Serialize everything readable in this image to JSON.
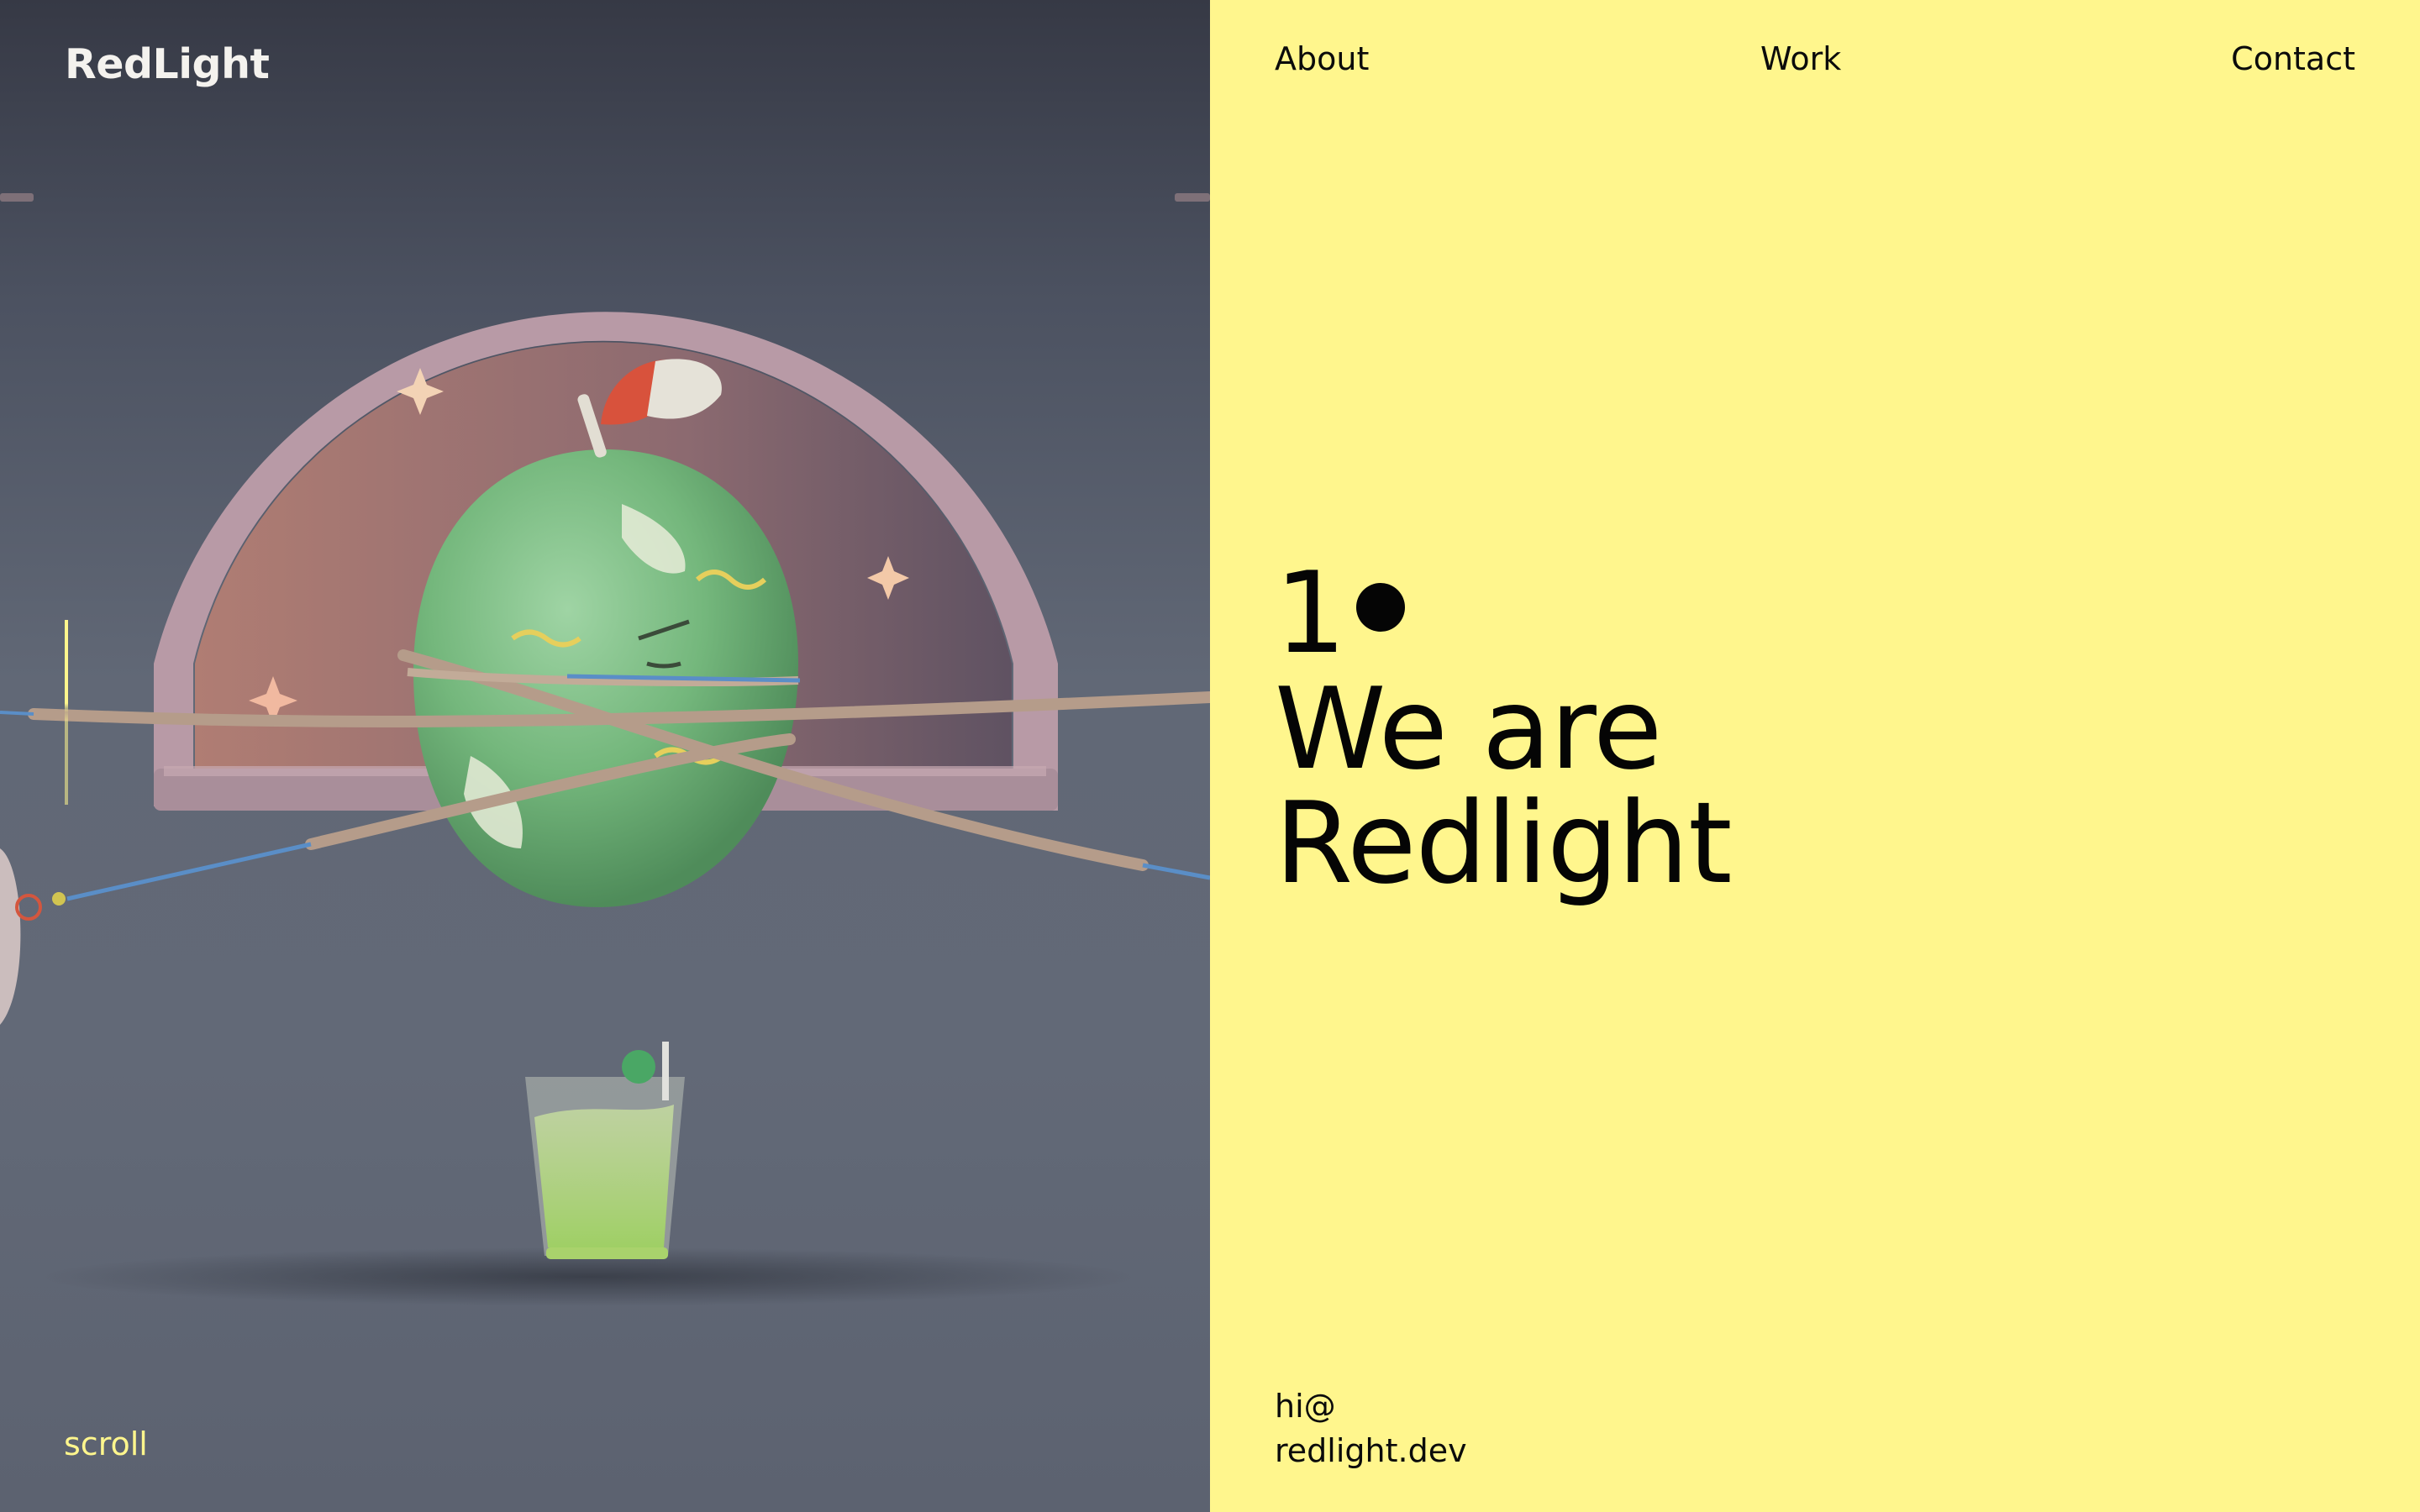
{
  "brand": {
    "logo_text": "RedLight"
  },
  "hero": {
    "scroll_label": "scroll",
    "scene_description_icon": "hero-3d-scene"
  },
  "nav": {
    "items": [
      {
        "label": "About"
      },
      {
        "label": "Work"
      },
      {
        "label": "Contact"
      }
    ]
  },
  "intro": {
    "section_number": "1",
    "headline_line_1": "We are",
    "headline_line_2": "Redlight"
  },
  "contact": {
    "email_line_1": "hi@",
    "email_line_2": "redlight.dev"
  },
  "colors": {
    "panel_yellow": "#fff68d",
    "hero_dark": "#5c6270",
    "text_dark": "#050505",
    "accent_yellow": "#fff68d"
  }
}
